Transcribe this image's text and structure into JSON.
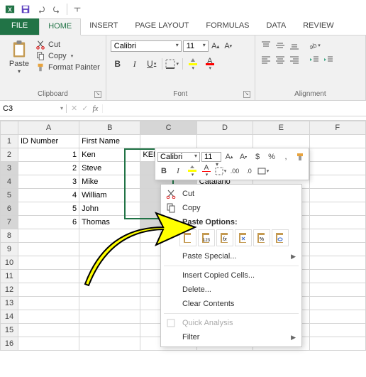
{
  "qat": {
    "icons": [
      "excel",
      "save",
      "undo",
      "redo"
    ]
  },
  "tabs": {
    "file": "FILE",
    "home": "HOME",
    "insert": "INSERT",
    "page_layout": "PAGE LAYOUT",
    "formulas": "FORMULAS",
    "data": "DATA",
    "review": "REVIEW"
  },
  "ribbon": {
    "clipboard": {
      "paste": "Paste",
      "cut": "Cut",
      "copy": "Copy",
      "format_painter": "Format Painter",
      "label": "Clipboard"
    },
    "font": {
      "name": "Calibri",
      "size": "11",
      "label": "Font",
      "bold": "B",
      "italic": "I",
      "underline": "U"
    },
    "alignment": {
      "label": "Alignment"
    }
  },
  "namebox": "C3",
  "fx": "fx",
  "columns": [
    "A",
    "B",
    "C",
    "D",
    "E",
    "F"
  ],
  "rows": [
    {
      "n": "1",
      "a": "ID Number",
      "b": "First Name"
    },
    {
      "n": "2",
      "a": "1",
      "b": "Ken",
      "c": "KEN"
    },
    {
      "n": "3",
      "a": "2",
      "b": "Steve"
    },
    {
      "n": "4",
      "a": "3",
      "b": "Mike",
      "d": "Catalano"
    },
    {
      "n": "5",
      "a": "4",
      "b": "William"
    },
    {
      "n": "6",
      "a": "5",
      "b": "John"
    },
    {
      "n": "7",
      "a": "6",
      "b": "Thomas"
    }
  ],
  "mini": {
    "font": "Calibri",
    "size": "11",
    "currency": "$",
    "percent": "%"
  },
  "context": {
    "cut": "Cut",
    "copy": "Copy",
    "paste_hdr": "Paste Options:",
    "paste_special": "Paste Special...",
    "insert": "Insert Copied Cells...",
    "delete": "Delete...",
    "clear": "Clear Contents",
    "quick": "Quick Analysis",
    "filter": "Filter"
  }
}
